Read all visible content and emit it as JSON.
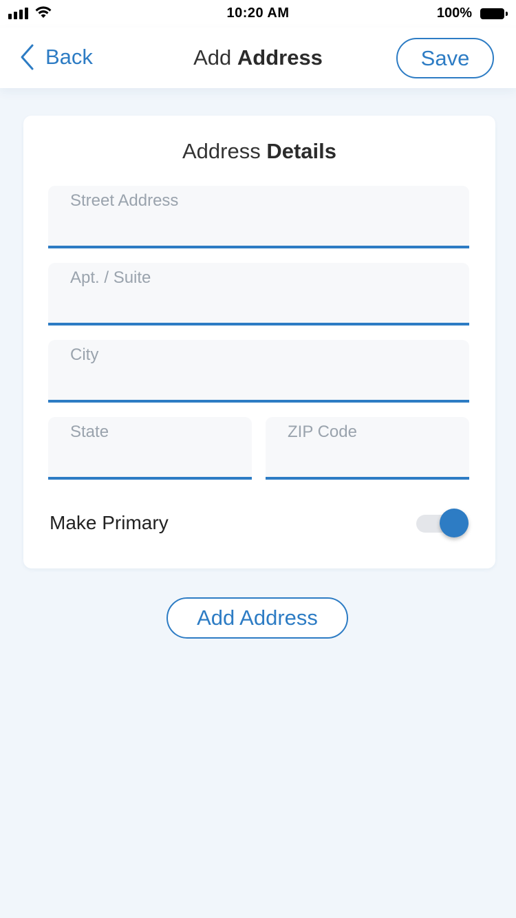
{
  "status_bar": {
    "time": "10:20 AM",
    "battery_percent": "100%",
    "signal_icon": "cellular-signal-icon",
    "wifi_icon": "wifi-icon",
    "battery_icon": "battery-icon"
  },
  "nav": {
    "back_label": "Back",
    "back_icon": "chevron-left-icon",
    "title_light": "Add",
    "title_bold": "Address",
    "save_label": "Save"
  },
  "card": {
    "title_light": "Address",
    "title_bold": "Details",
    "fields": {
      "street": {
        "placeholder": "Street Address",
        "value": ""
      },
      "apt": {
        "placeholder": "Apt. / Suite",
        "value": ""
      },
      "city": {
        "placeholder": "City",
        "value": ""
      },
      "state": {
        "placeholder": "State",
        "value": ""
      },
      "zip": {
        "placeholder": "ZIP Code",
        "value": ""
      }
    },
    "make_primary": {
      "label": "Make Primary",
      "enabled": true
    }
  },
  "add_address_label": "Add Address",
  "colors": {
    "accent": "#2d7cc4",
    "background": "#f1f6fb",
    "field_bg": "#f7f8fa",
    "placeholder": "#9aa3ad"
  }
}
